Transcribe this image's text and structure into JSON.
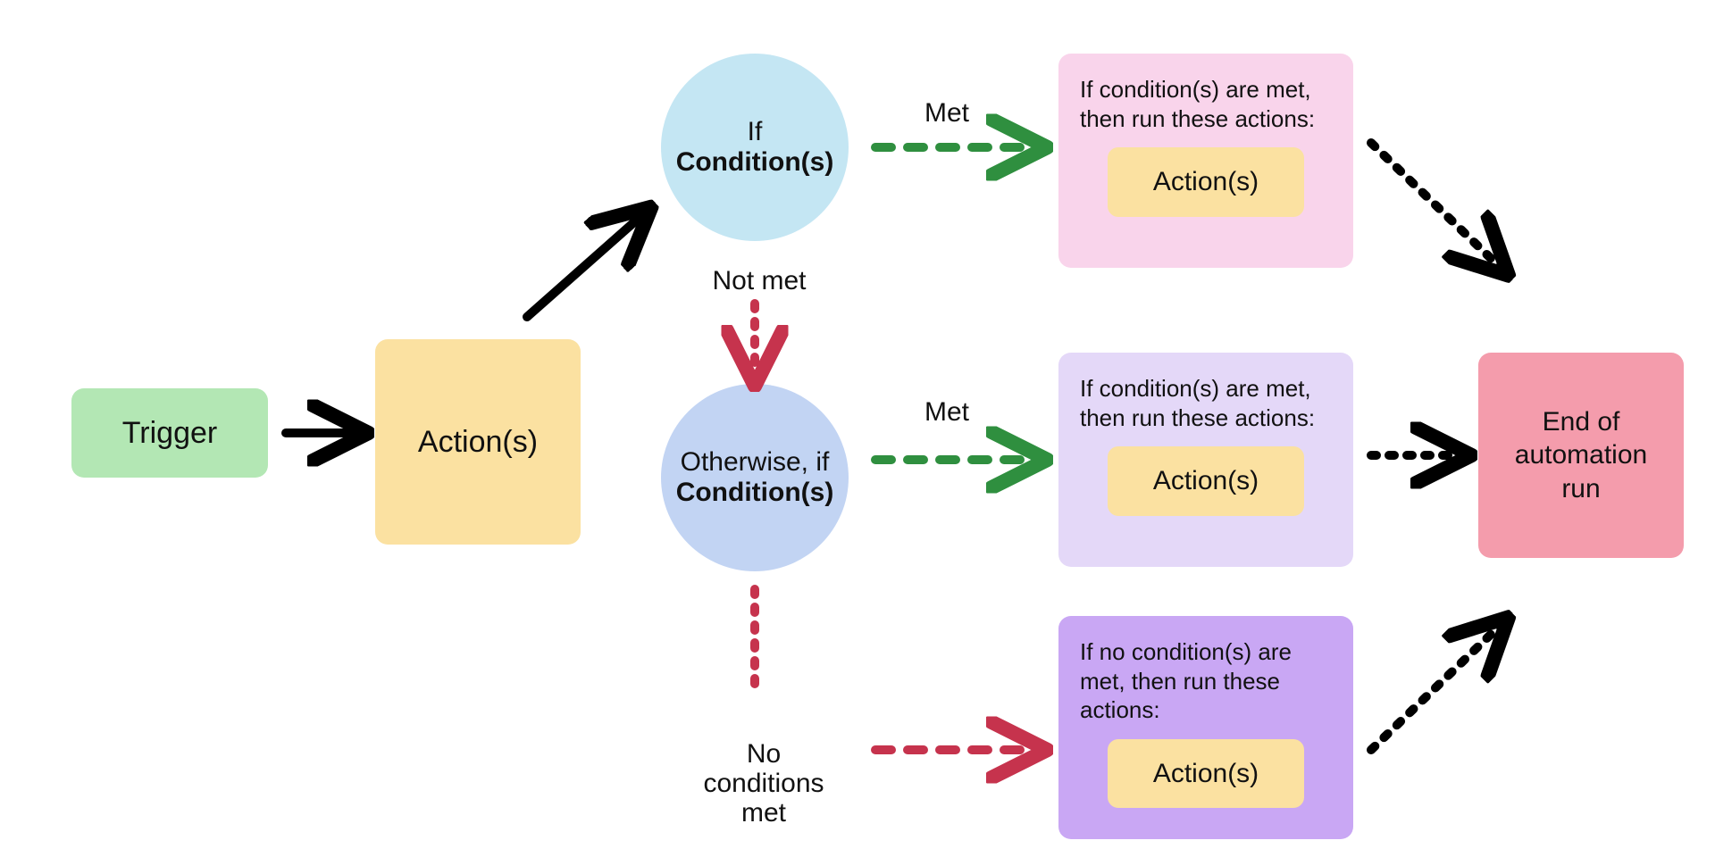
{
  "trigger": {
    "label": "Trigger"
  },
  "actions": {
    "label": "Action(s)"
  },
  "cond1": {
    "line1": "If",
    "line2": "Condition(s)"
  },
  "cond2": {
    "line1": "Otherwise, if",
    "line2": "Condition(s)"
  },
  "edge_labels": {
    "met1": "Met",
    "not_met": "Not met",
    "met2": "Met",
    "no_cond": "No\nconditions\nmet"
  },
  "group1": {
    "desc": "If condition(s) are met, then run these actions:",
    "inner": "Action(s)"
  },
  "group2": {
    "desc": "If condition(s) are met, then run these actions:",
    "inner": "Action(s)"
  },
  "group3": {
    "desc": "If no condition(s) are met, then run these actions:",
    "inner": "Action(s)"
  },
  "end": {
    "label": "End of automation run"
  },
  "colors": {
    "trigger": "#b3e7b4",
    "actions": "#fbe1a1",
    "cond1": "#c4e6f3",
    "cond2": "#c2d4f3",
    "group1": "#f9d4eb",
    "group2": "#e4d8f8",
    "group3": "#c9a7f4",
    "end": "#f49cac"
  }
}
